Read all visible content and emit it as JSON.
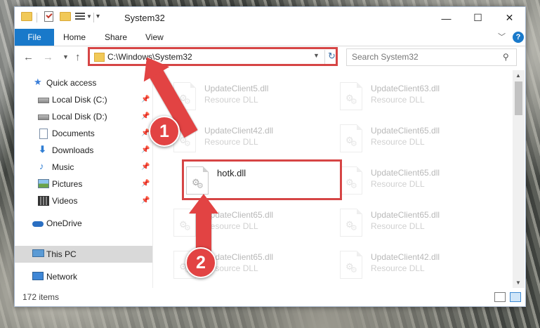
{
  "window": {
    "title": "System32"
  },
  "ribbon": {
    "tabs": [
      "File",
      "Home",
      "Share",
      "View"
    ],
    "help": "?",
    "expand": "﹀"
  },
  "titlebar": {
    "minimize": "—",
    "maximize": "☐",
    "close": "✕"
  },
  "address": {
    "path": "C:\\Windows\\System32"
  },
  "search": {
    "placeholder": "Search System32"
  },
  "nav": {
    "items": [
      {
        "label": "Quick access",
        "icon": "star-icon",
        "pinned": false
      },
      {
        "label": "Local Disk (C:)",
        "icon": "drive-icon",
        "pinned": true
      },
      {
        "label": "Local Disk (D:)",
        "icon": "drive-icon",
        "pinned": true
      },
      {
        "label": "Documents",
        "icon": "document-icon",
        "pinned": true
      },
      {
        "label": "Downloads",
        "icon": "download-icon",
        "pinned": true
      },
      {
        "label": "Music",
        "icon": "music-icon",
        "pinned": true
      },
      {
        "label": "Pictures",
        "icon": "pictures-icon",
        "pinned": true
      },
      {
        "label": "Videos",
        "icon": "videos-icon",
        "pinned": true
      },
      {
        "label": "OneDrive",
        "icon": "onedrive-icon",
        "pinned": false
      },
      {
        "label": "This PC",
        "icon": "this-pc-icon",
        "pinned": false,
        "selected": true
      },
      {
        "label": "Network",
        "icon": "network-icon",
        "pinned": false
      }
    ]
  },
  "files": [
    {
      "name": "UpdateClient5.dll",
      "type": "Resource DLL"
    },
    {
      "name": "UpdateClient63.dll",
      "type": "Resource DLL"
    },
    {
      "name": "UpdateClient42.dll",
      "type": "Resource DLL"
    },
    {
      "name": "UpdateClient65.dll",
      "type": "Resource DLL"
    },
    {
      "name": "hotk.dll",
      "type": ""
    },
    {
      "name": "UpdateClient65.dll",
      "type": "Resource DLL"
    },
    {
      "name": "UpdateClient65.dll",
      "type": "Resource DLL"
    },
    {
      "name": "UpdateClient65.dll",
      "type": "Resource DLL"
    },
    {
      "name": "UpdateClient65.dll",
      "type": "Resource DLL"
    },
    {
      "name": "UpdateClient42.dll",
      "type": "Resource DLL"
    }
  ],
  "status": {
    "items": "172 items"
  },
  "callouts": [
    {
      "number": "1"
    },
    {
      "number": "2"
    }
  ],
  "colors": {
    "accent": "#1979ca",
    "highlight": "#d64545",
    "callout": "#e24343",
    "selected": "#d9d9d9"
  }
}
